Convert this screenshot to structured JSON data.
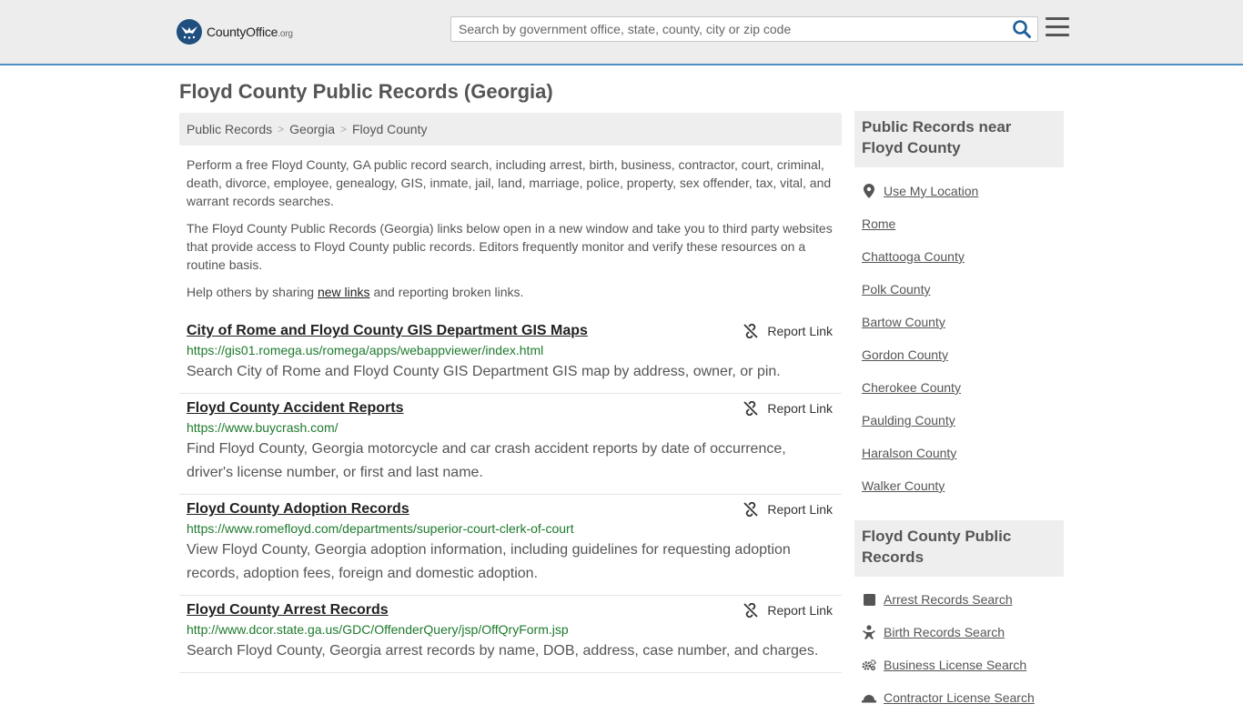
{
  "header": {
    "logo_main": "CountyOffice",
    "logo_suffix": ".org",
    "search_placeholder": "Search by government office, state, county, city or zip code"
  },
  "page": {
    "title": "Floyd County Public Records (Georgia)"
  },
  "breadcrumb": [
    "Public Records",
    "Georgia",
    "Floyd County"
  ],
  "intro": {
    "p1": "Perform a free Floyd County, GA public record search, including arrest, birth, business, contractor, court, criminal, death, divorce, employee, genealogy, GIS, inmate, jail, land, marriage, police, property, sex offender, tax, vital, and warrant records searches.",
    "p2": "The Floyd County Public Records (Georgia) links below open in a new window and take you to third party websites that provide access to Floyd County public records. Editors frequently monitor and verify these resources on a routine basis.",
    "p3_before": "Help others by sharing ",
    "p3_link": "new links",
    "p3_after": " and reporting broken links."
  },
  "report_label": "Report Link",
  "records": [
    {
      "title": "City of Rome and Floyd County GIS Department GIS Maps",
      "url": "https://gis01.romega.us/romega/apps/webappviewer/index.html",
      "desc": "Search City of Rome and Floyd County GIS Department GIS map by address, owner, or pin."
    },
    {
      "title": "Floyd County Accident Reports",
      "url": "https://www.buycrash.com/",
      "desc": "Find Floyd County, Georgia motorcycle and car crash accident reports by date of occurrence, driver's license number, or first and last name."
    },
    {
      "title": "Floyd County Adoption Records",
      "url": "https://www.romefloyd.com/departments/superior-court-clerk-of-court",
      "desc": "View Floyd County, Georgia adoption information, including guidelines for requesting adoption records, adoption fees, foreign and domestic adoption."
    },
    {
      "title": "Floyd County Arrest Records",
      "url": "http://www.dcor.state.ga.us/GDC/OffenderQuery/jsp/OffQryForm.jsp",
      "desc": "Search Floyd County, Georgia arrest records by name, DOB, address, case number, and charges."
    }
  ],
  "sidebar": {
    "near_title": "Public Records near Floyd County",
    "use_location": "Use My Location",
    "near_items": [
      "Rome",
      "Chattooga County",
      "Polk County",
      "Bartow County",
      "Gordon County",
      "Cherokee County",
      "Paulding County",
      "Haralson County",
      "Walker County"
    ],
    "records_title": "Floyd County Public Records",
    "record_items": [
      {
        "label": "Arrest Records Search",
        "icon": "square-icon"
      },
      {
        "label": "Birth Records Search",
        "icon": "baby-icon"
      },
      {
        "label": "Business License Search",
        "icon": "gears-icon"
      },
      {
        "label": "Contractor License Search",
        "icon": "hardhat-icon"
      }
    ]
  },
  "colors": {
    "accent": "#4d8fc3",
    "url_green": "#1d7a2c",
    "logo_blue": "#1e4f7f"
  }
}
